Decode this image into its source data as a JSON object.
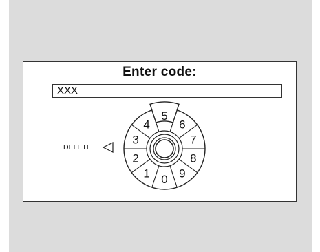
{
  "dialog": {
    "title": "Enter code:",
    "code_value": "XXX",
    "delete_label": "DELETE"
  },
  "dial": {
    "digits": [
      "0",
      "1",
      "2",
      "3",
      "4",
      "5",
      "6",
      "7",
      "8",
      "9"
    ],
    "selected": "5"
  }
}
